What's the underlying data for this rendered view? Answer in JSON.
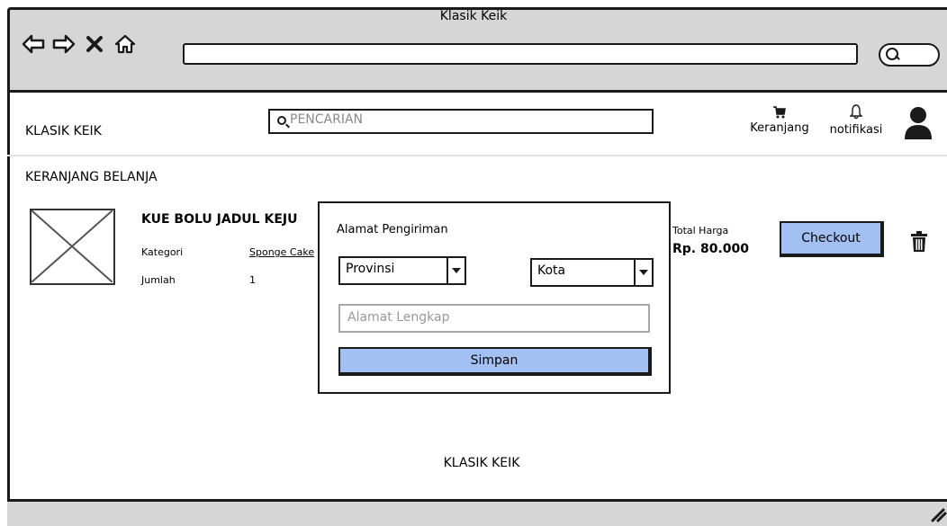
{
  "window": {
    "title": "Klasik Keik"
  },
  "header": {
    "brand": "KLASIK KEIK",
    "search_placeholder": "PENCARIAN",
    "cart_label": "Keranjang",
    "notification_label": "notifikasi"
  },
  "cart_page": {
    "section_title": "KERANJANG BELANJA",
    "product": {
      "name": "KUE BOLU JADUL KEJU",
      "category_label": "Kategori",
      "category_value": "Sponge Cake",
      "quantity_label": "Jumlah",
      "quantity_value": "1"
    },
    "total_label": "Total Harga",
    "total_value": "Rp. 80.000",
    "checkout_label": "Checkout"
  },
  "modal": {
    "title": "Alamat Pengiriman",
    "province_select": "Provinsi",
    "city_select": "Kota",
    "address_placeholder": "Alamat Lengkap",
    "save_label": "Simpan"
  },
  "footer": {
    "brand": "KLASIK KEIK"
  },
  "colors": {
    "button_blue": "#a2c0f2",
    "chrome_gray": "#d6d6d6"
  },
  "icons": [
    "back-arrow-icon",
    "forward-arrow-icon",
    "close-icon",
    "home-icon",
    "search-icon",
    "cart-icon",
    "bell-icon",
    "user-icon",
    "trash-icon",
    "resize-grip-icon"
  ]
}
